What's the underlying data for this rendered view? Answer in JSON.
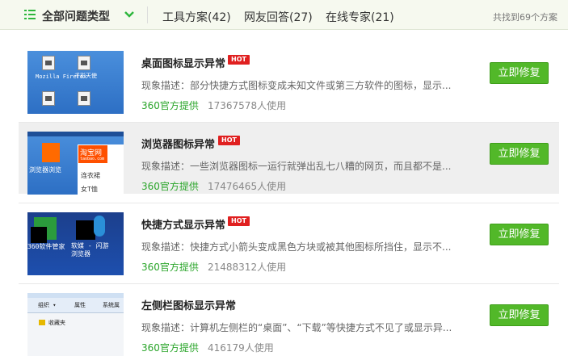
{
  "header": {
    "type_menu_label": "全部问题类型",
    "tabs": [
      {
        "label": "工具方案(42)"
      },
      {
        "label": "网友回答(27)"
      },
      {
        "label": "在线专家(21)"
      }
    ],
    "found_text": "共找到69个方案"
  },
  "colors": {
    "accent_green": "#52b829",
    "hot_red": "#e02020",
    "provider_green": "#2aa52a"
  },
  "items": [
    {
      "title": "桌面图标显示异常",
      "badge": "HOT",
      "desc": "现象描述：部分快捷方式图标变成未知文件或第三方软件的图标，显示...",
      "provider": "360官方提供",
      "users": "17367578人使用",
      "button": "立即修复",
      "thumb_labels": [
        "Mozilla Firefox",
        "千彩天使"
      ]
    },
    {
      "title": "浏览器图标异常",
      "badge": "HOT",
      "desc": "现象描述：一些浏览器图标一运行就弹出乱七八糟的网页，而且都不是...",
      "provider": "360官方提供",
      "users": "17476465人使用",
      "button": "立即修复",
      "thumb_labels": [
        "淘宝网",
        "taobao.com",
        "连衣裙",
        "女T恤",
        "浏览器浏览"
      ]
    },
    {
      "title": "快捷方式显示异常",
      "badge": "HOT",
      "desc": "现象描述：快捷方式小箭头变成黑色方块或被其他图标所挡住，显示不...",
      "provider": "360官方提供",
      "users": "21488312人使用",
      "button": "立即修复",
      "thumb_labels": [
        "360软件管家",
        "软媒 - 闪游浏览器"
      ]
    },
    {
      "title": "左侧栏图标显示异常",
      "badge": "",
      "desc": "现象描述：计算机左侧栏的“桌面”、“下载”等快捷方式不见了或显示异...",
      "provider": "360官方提供",
      "users": "416179人使用",
      "button": "立即修复",
      "thumb_labels": [
        "组织 ▾",
        "属性",
        "系统属",
        "收藏夹"
      ]
    }
  ]
}
